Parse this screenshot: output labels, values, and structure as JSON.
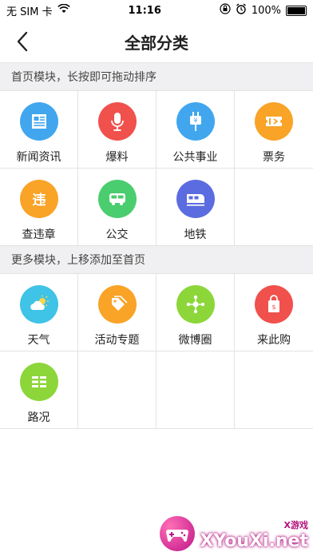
{
  "status_bar": {
    "carrier": "无 SIM 卡",
    "time": "11:16",
    "battery": "100%"
  },
  "nav": {
    "title": "全部分类"
  },
  "sections": [
    {
      "header": "首页模块，长按即可拖动排序",
      "items": [
        {
          "label": "新闻资讯",
          "icon": "news-icon",
          "color": "#41A6EE"
        },
        {
          "label": "爆料",
          "icon": "microphone-icon",
          "color": "#F0514D"
        },
        {
          "label": "公共事业",
          "icon": "plug-icon",
          "color": "#41A6EE"
        },
        {
          "label": "票务",
          "icon": "ticket-icon",
          "color": "#F9A327"
        },
        {
          "label": "查违章",
          "icon": "violation-icon",
          "color": "#F9A327"
        },
        {
          "label": "公交",
          "icon": "bus-icon",
          "color": "#4ACD6F"
        },
        {
          "label": "地铁",
          "icon": "subway-icon",
          "color": "#5B6CE0"
        }
      ]
    },
    {
      "header": "更多模块，上移添加至首页",
      "items": [
        {
          "label": "天气",
          "icon": "weather-icon",
          "color": "#3FC3E6"
        },
        {
          "label": "活动专题",
          "icon": "tag-icon",
          "color": "#F9A327"
        },
        {
          "label": "微博圈",
          "icon": "network-icon",
          "color": "#8CD63A"
        },
        {
          "label": "来此购",
          "icon": "shopping-bag-icon",
          "color": "#F0514D"
        },
        {
          "label": "路况",
          "icon": "road-icon",
          "color": "#8CD63A"
        }
      ]
    }
  ],
  "watermark": {
    "small": "X游戏",
    "big": "XYouXi.net"
  }
}
